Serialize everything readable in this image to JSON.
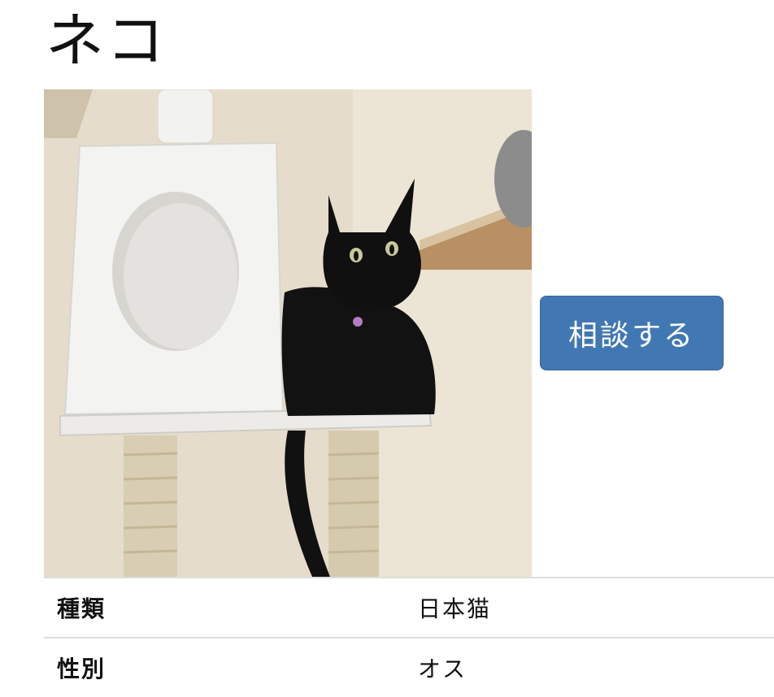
{
  "page": {
    "title": "ネコ"
  },
  "actions": {
    "consult_label": "相談する"
  },
  "details": {
    "rows": [
      {
        "label": "種類",
        "value": "日本猫"
      },
      {
        "label": "性別",
        "value": "オス"
      }
    ]
  },
  "colors": {
    "button": "#4178b4",
    "divider": "#dddddd"
  }
}
